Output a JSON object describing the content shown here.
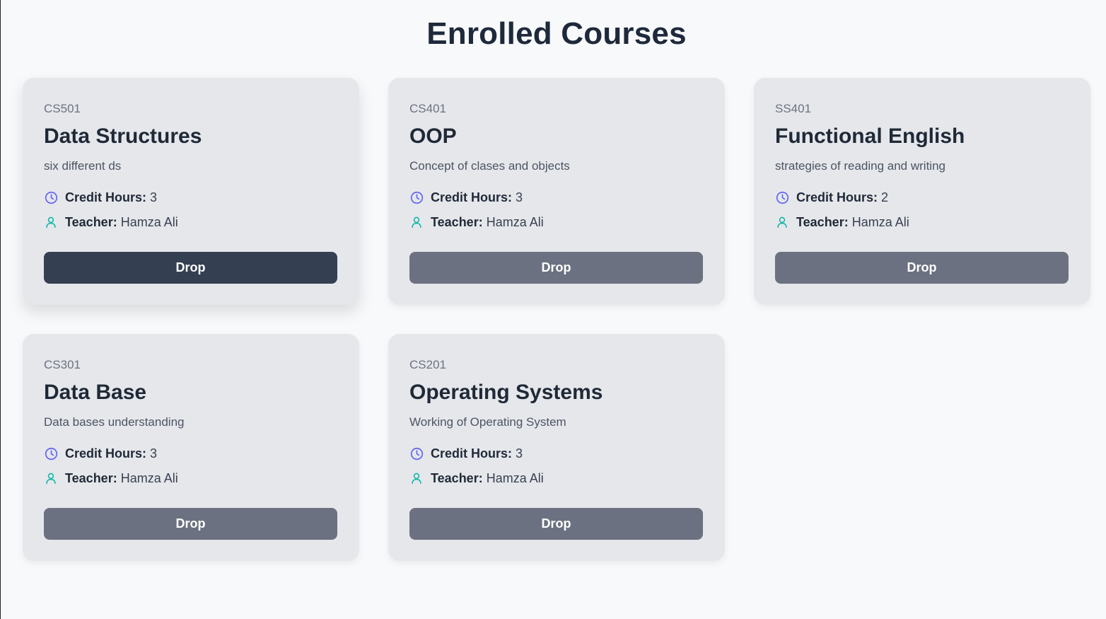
{
  "page": {
    "title": "Enrolled Courses"
  },
  "labels": {
    "credit_hours": "Credit Hours:",
    "teacher": "Teacher:"
  },
  "colors": {
    "clock_icon": "#6366f1",
    "user_icon": "#14b8a6",
    "button": "#6b7180",
    "button_hover": "#343f52",
    "card_bg": "#e6e7eb"
  },
  "courses": [
    {
      "code": "CS501",
      "title": "Data Structures",
      "description": "six different ds",
      "credit_hours": "3",
      "teacher": "Hamza Ali",
      "button_label": "Drop"
    },
    {
      "code": "CS401",
      "title": "OOP",
      "description": "Concept of clases and objects",
      "credit_hours": "3",
      "teacher": "Hamza Ali",
      "button_label": "Drop"
    },
    {
      "code": "SS401",
      "title": "Functional English",
      "description": "strategies of reading and writing",
      "credit_hours": "2",
      "teacher": "Hamza Ali",
      "button_label": "Drop"
    },
    {
      "code": "CS301",
      "title": "Data Base",
      "description": "Data bases understanding",
      "credit_hours": "3",
      "teacher": "Hamza Ali",
      "button_label": "Drop"
    },
    {
      "code": "CS201",
      "title": "Operating Systems",
      "description": "Working of Operating System",
      "credit_hours": "3",
      "teacher": "Hamza Ali",
      "button_label": "Drop"
    }
  ]
}
